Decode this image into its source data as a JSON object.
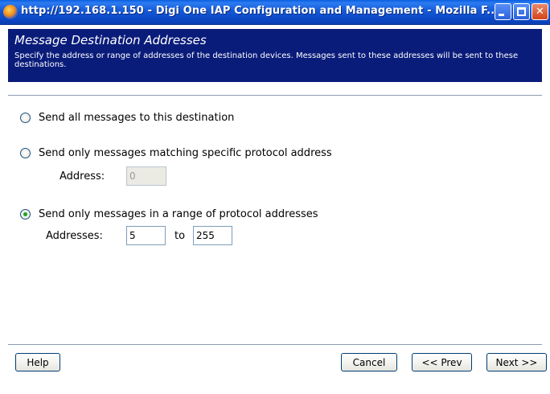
{
  "window": {
    "title": "http://192.168.1.150 - Digi One IAP Configuration and Management - Mozilla F...",
    "app_icon": "firefox-icon",
    "controls": [
      "minimize-icon",
      "maximize-icon",
      "close-icon"
    ]
  },
  "header": {
    "title": "Message Destination Addresses",
    "description": "Specify the address or range of addresses of the destination devices. Messages sent to these addresses will be sent to these destinations.",
    "background_color": "#0a1c7a"
  },
  "options": [
    {
      "label": "Send all messages to this destination",
      "selected": false
    },
    {
      "label": "Send only messages matching specific protocol address",
      "selected": false,
      "address_label": "Address:",
      "address_value": "0",
      "disabled": true
    },
    {
      "label": "Send only messages in a range of protocol addresses",
      "selected": true,
      "addresses_label": "Addresses:",
      "from_value": "5",
      "to_label": "to",
      "to_value": "255"
    }
  ],
  "footer": {
    "help_label": "Help",
    "cancel_label": "Cancel",
    "prev_label": "<< Prev",
    "next_label": "Next >>"
  }
}
